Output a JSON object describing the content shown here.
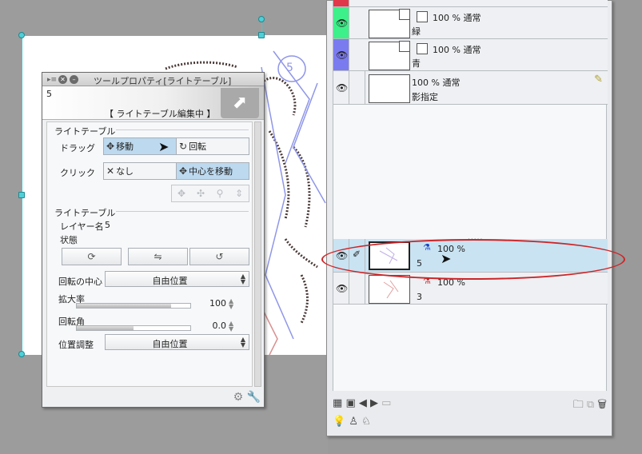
{
  "tool_property": {
    "title": "ツールプロパティ[ライトテーブル]",
    "header_number": "5",
    "mode_banner": "【 ライトテーブル編集中 】",
    "section_lighttable": "ライトテーブル",
    "drag_label": "ドラッグ",
    "drag_options": [
      "移動",
      "回転"
    ],
    "click_label": "クリック",
    "click_options": [
      "なし",
      "中心を移動"
    ],
    "section_lighttable2": "ライトテーブル",
    "layer_name_label": "レイヤー名",
    "layer_name_value": "5",
    "state_label": "状態",
    "rotation_center_label": "回転の中心",
    "rotation_center_value": "自由位置",
    "scale_label": "拡大率",
    "scale_value": "100",
    "scale_fill_pct": 83,
    "angle_label": "回転角",
    "angle_value": "0.0",
    "angle_fill_pct": 50,
    "position_label": "位置調整",
    "position_value": "自由位置"
  },
  "layers": {
    "top_rows": [
      {
        "info": "100 % 通常",
        "name": "緑",
        "color": "#3df08a"
      },
      {
        "info": "100 % 通常",
        "name": "青",
        "color": "#7b7bf0"
      },
      {
        "info": "100 % 通常",
        "name": "影指定",
        "color": ""
      }
    ],
    "lighttable_rows": [
      {
        "info": "100 %",
        "name": "5",
        "selected": true
      },
      {
        "info": "100 %",
        "name": "3",
        "selected": false
      }
    ]
  },
  "canvas": {
    "sketch_label": "5"
  },
  "colors": {
    "selection_blue": "#c9e3f2",
    "annotation_red": "#cc2528",
    "handle": "#4fd0d8"
  }
}
